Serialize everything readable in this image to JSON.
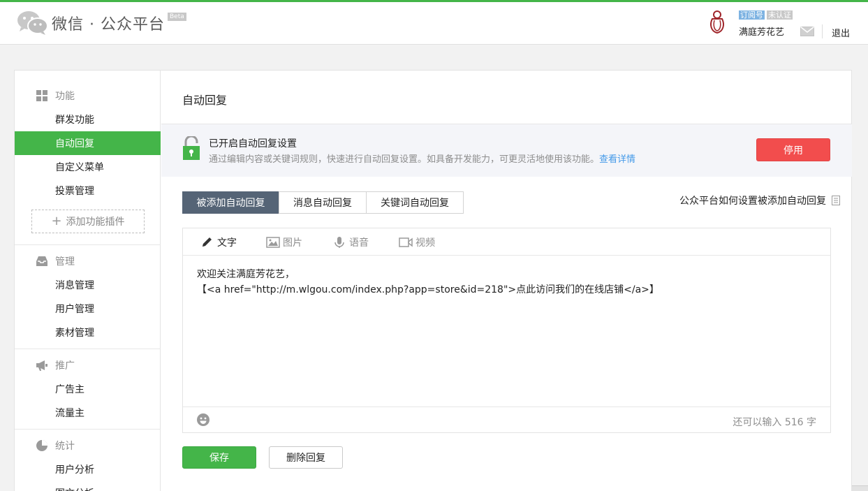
{
  "header": {
    "logo_text": "微信 · 公众平台",
    "beta_label": "Beta",
    "account": {
      "tag_subscription": "订阅号",
      "tag_unverified": "未认证",
      "name": "满庭芳花艺",
      "logout_label": "退出"
    }
  },
  "sidebar": {
    "groups": [
      {
        "title": "功能",
        "icon": "grid-icon",
        "items": [
          "群发功能",
          "自动回复",
          "自定义菜单",
          "投票管理"
        ]
      },
      {
        "title": "管理",
        "icon": "inbox-icon",
        "items": [
          "消息管理",
          "用户管理",
          "素材管理"
        ]
      },
      {
        "title": "推广",
        "icon": "megaphone-icon",
        "items": [
          "广告主",
          "流量主"
        ]
      },
      {
        "title": "统计",
        "icon": "pie-chart-icon",
        "items": [
          "用户分析",
          "图文分析"
        ]
      }
    ],
    "active_item": "自动回复",
    "add_plugin_label": "添加功能插件"
  },
  "main": {
    "title": "自动回复",
    "notice": {
      "title": "已开启自动回复设置",
      "desc": "通过编辑内容或关键词规则，快速进行自动回复设置。如具备开发能力，可更灵活地使用该功能。",
      "link": "查看详情",
      "stop_button": "停用"
    },
    "tabs": [
      "被添加自动回复",
      "消息自动回复",
      "关键词自动回复"
    ],
    "active_tab": 0,
    "help_link": "公众平台如何设置被添加自动回复",
    "editor": {
      "tools": [
        "文字",
        "图片",
        "语音",
        "视频"
      ],
      "active_tool": 0,
      "content_line1": "欢迎关注满庭芳花艺，",
      "content_line2": "【<a href=\"http://m.wlgou.com/index.php?app=store&id=218\">点此访问我们的在线店铺</a>】",
      "counter": "还可以输入 516 字"
    },
    "save_button": "保存",
    "delete_button": "删除回复"
  },
  "colors": {
    "brand_green": "#44b549",
    "danger_red": "#f24d4d",
    "tab_active": "#556476",
    "link_blue": "#459ae9"
  }
}
